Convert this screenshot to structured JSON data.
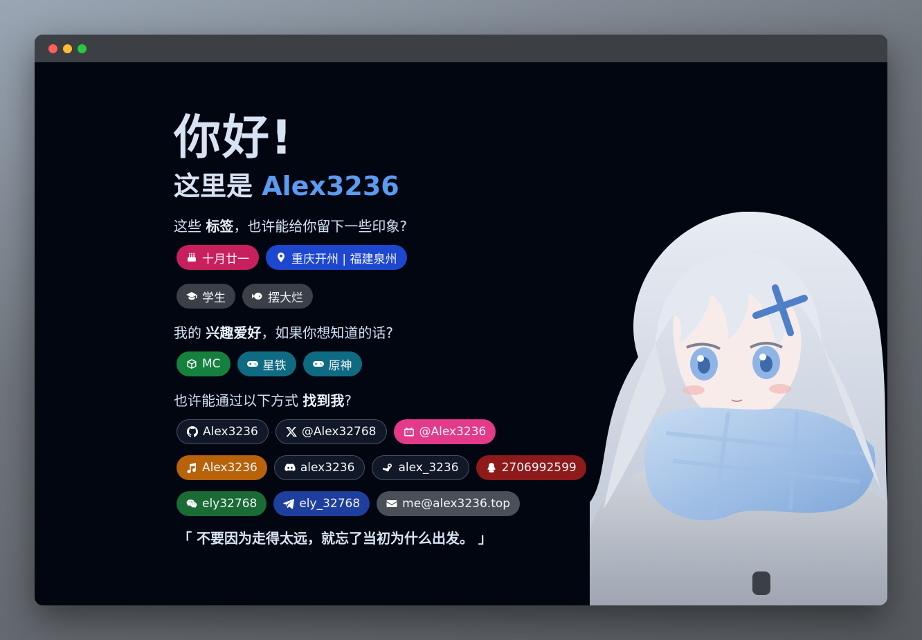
{
  "window": {
    "buttons": [
      "close",
      "minimize",
      "maximize"
    ]
  },
  "hero": {
    "greeting": "你好!",
    "intro_prefix": "这里是 ",
    "name": "Alex3236"
  },
  "tags_section": {
    "q_prefix": "这些 ",
    "q_bold": "标签",
    "q_suffix": "，也许能给你留下一些印象?",
    "tags": [
      {
        "label": "十月廿一",
        "icon": "cake-icon",
        "color": "#c81f5d"
      },
      {
        "label": "重庆开州 | 福建泉州",
        "icon": "location-pin-icon",
        "color": "#1e47d0"
      },
      {
        "label": "学生",
        "icon": "graduation-cap-icon",
        "color": "#3a3f48"
      },
      {
        "label": "摆大烂",
        "icon": "fish-icon",
        "color": "#3a3f48"
      }
    ]
  },
  "hobby_section": {
    "q_prefix": "我的 ",
    "q_bold": "兴趣爱好",
    "q_suffix": "，如果你想知道的话?",
    "hobbies": [
      {
        "label": "MC",
        "icon": "cube-icon"
      },
      {
        "label": "星铁",
        "icon": "gamepad-icon"
      },
      {
        "label": "原神",
        "icon": "gamepad-icon"
      }
    ]
  },
  "contact_section": {
    "q_prefix": "也许能通过以下方式 ",
    "q_bold": "找到我",
    "q_suffix": "?",
    "contacts": [
      {
        "label": "Alex3236",
        "icon": "github-icon"
      },
      {
        "label": "@Alex32768",
        "icon": "x-twitter-icon"
      },
      {
        "label": "@Alex3236",
        "icon": "bilibili-icon"
      },
      {
        "label": "Alex3236",
        "icon": "music-note-icon"
      },
      {
        "label": "alex3236",
        "icon": "discord-icon"
      },
      {
        "label": "alex_3236",
        "icon": "steam-icon"
      },
      {
        "label": "2706992599",
        "icon": "qq-icon"
      },
      {
        "label": "ely32768",
        "icon": "wechat-icon"
      },
      {
        "label": "ely_32768",
        "icon": "telegram-icon"
      },
      {
        "label": "me@alex3236.top",
        "icon": "envelope-icon"
      }
    ]
  },
  "quote": "「 不要因为走得太远，就忘了当初为什么出发。 」",
  "colors": {
    "background": "#020611",
    "accent": "#5b9bf0"
  }
}
